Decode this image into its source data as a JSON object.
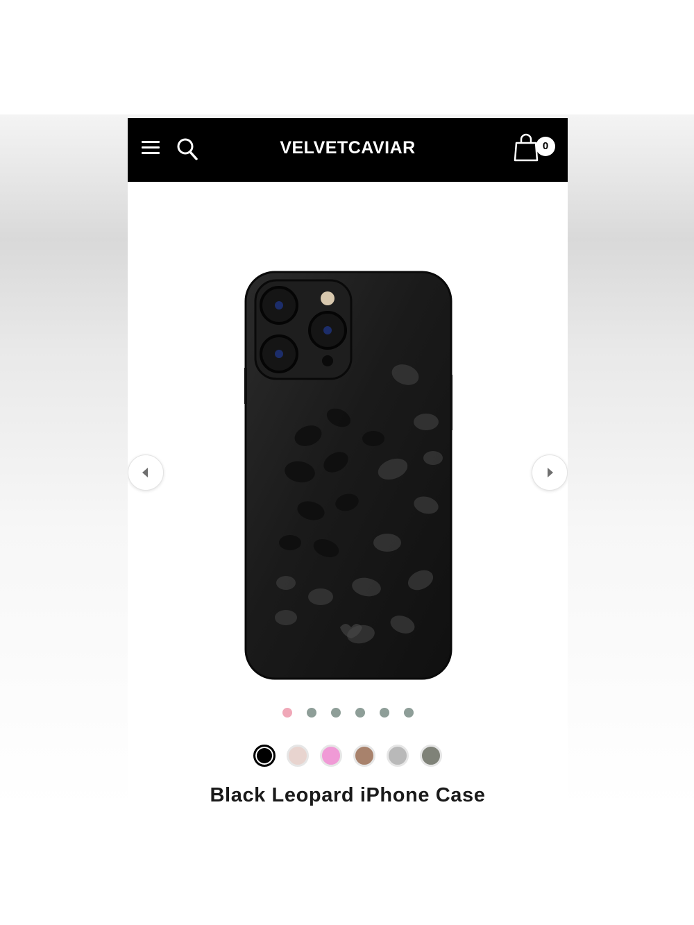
{
  "header": {
    "brand": "VELVETCAVIAR",
    "cart_count": "0",
    "icons": [
      "menu-icon",
      "search-icon",
      "shopping-bag-icon"
    ]
  },
  "carousel": {
    "prev_icon": "chevron-left-icon",
    "next_icon": "chevron-right-icon",
    "dots": [
      {
        "color": "#f0a8b8",
        "active": true
      },
      {
        "color": "#8e9e98",
        "active": false
      },
      {
        "color": "#8e9e98",
        "active": false
      },
      {
        "color": "#8e9e98",
        "active": false
      },
      {
        "color": "#8e9e98",
        "active": false
      },
      {
        "color": "#8e9e98",
        "active": false
      }
    ]
  },
  "product": {
    "title": "Black Leopard iPhone Case",
    "image_icon": "black-leopard-phone-case",
    "swatches": [
      {
        "color": "#000000",
        "selected": true
      },
      {
        "color": "#e8d4cf",
        "selected": false
      },
      {
        "color": "#f09ad6",
        "selected": false
      },
      {
        "color": "#a8826c",
        "selected": false
      },
      {
        "color": "#b9b9b9",
        "selected": false
      },
      {
        "color": "#7f8278",
        "selected": false
      }
    ]
  }
}
